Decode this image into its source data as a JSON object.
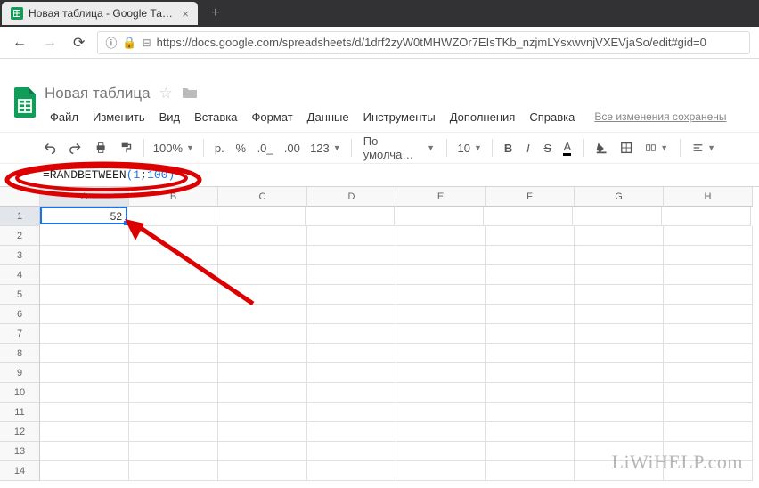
{
  "browser": {
    "tab_title": "Новая таблица - Google Табли",
    "url": "https://docs.google.com/spreadsheets/d/1drf2zyW0tMHWZOr7EIsTKb_nzjmLYsxwvnjVXEVjaSo/edit#gid=0",
    "url_host": "google.com"
  },
  "doc": {
    "title": "Новая таблица",
    "menus": [
      "Файл",
      "Изменить",
      "Вид",
      "Вставка",
      "Формат",
      "Данные",
      "Инструменты",
      "Дополнения",
      "Справка"
    ],
    "changes_text": "Все изменения сохранены"
  },
  "toolbar": {
    "zoom": "100%",
    "currency": "р.",
    "decimal_format": "123",
    "font": "По умолча…",
    "font_size": "10"
  },
  "formula": {
    "text_prefix": "=RANDBETWEEN",
    "open": "(",
    "arg1": "1",
    "sep": ";",
    "arg2": "100",
    "close": ")"
  },
  "grid": {
    "columns": [
      "A",
      "B",
      "C",
      "D",
      "E",
      "F",
      "G",
      "H"
    ],
    "rows": [
      1,
      2,
      3,
      4,
      5,
      6,
      7,
      8,
      9,
      10,
      11,
      12,
      13,
      14
    ],
    "active_cell": "A1",
    "active_value": "52"
  },
  "watermark": "LiWiHELP.com"
}
